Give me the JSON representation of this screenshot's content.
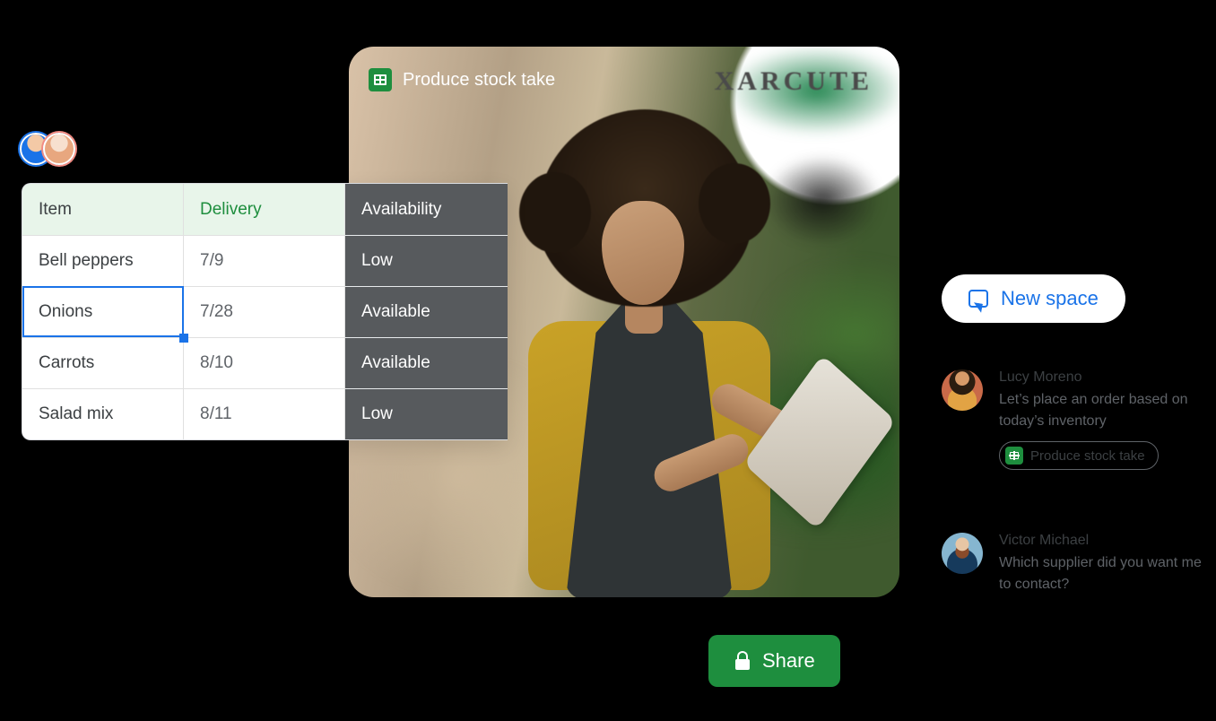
{
  "hero": {
    "doc_title": "Produce stock take",
    "background_sign": "XARCUTE"
  },
  "sheet": {
    "headers": {
      "item": "Item",
      "delivery": "Delivery",
      "availability": "Availability"
    },
    "rows": [
      {
        "item": "Bell peppers",
        "delivery": "7/9",
        "availability": "Low",
        "selected": false
      },
      {
        "item": "Onions",
        "delivery": "7/28",
        "availability": "Available",
        "selected": true
      },
      {
        "item": "Carrots",
        "delivery": "8/10",
        "availability": "Available",
        "selected": false
      },
      {
        "item": "Salad mix",
        "delivery": "8/11",
        "availability": "Low",
        "selected": false
      }
    ]
  },
  "share": {
    "label": "Share"
  },
  "chat": {
    "new_space_label": "New space",
    "messages": [
      {
        "author": "Lucy Moreno",
        "text": "Let’s place an order based on today’s inventory",
        "attachment": "Produce stock take"
      },
      {
        "author": "Victor Michael",
        "text": "Which supplier did you want me to contact?"
      }
    ]
  },
  "colors": {
    "brand_green": "#1e8e3e",
    "brand_blue": "#1a73e8"
  }
}
